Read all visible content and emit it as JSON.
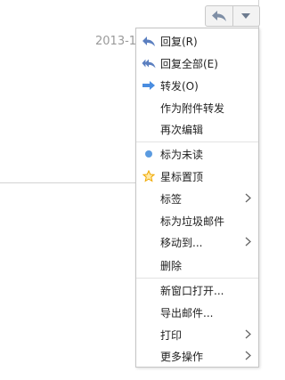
{
  "mail": {
    "date": "2013-1"
  },
  "toolbar": {
    "reply_icon": "reply-arrow-icon",
    "more_icon": "triangle-down-icon"
  },
  "colors": {
    "reply_icon": "#5b7fc0",
    "forward_icon": "#4a8de0",
    "unread_dot": "#5b9be0",
    "star": "#f0a800"
  },
  "menu": {
    "reply": "回复(R)",
    "reply_all": "回复全部(E)",
    "forward": "转发(O)",
    "forward_attachment": "作为附件转发",
    "edit_again": "再次编辑",
    "mark_unread": "标为未读",
    "star_pin": "星标置顶",
    "labels": "标签",
    "mark_spam": "标为垃圾邮件",
    "move_to": "移动到...",
    "delete": "删除",
    "open_new_window": "新窗口打开...",
    "export_mail": "导出邮件...",
    "print": "打印",
    "more_actions": "更多操作"
  }
}
